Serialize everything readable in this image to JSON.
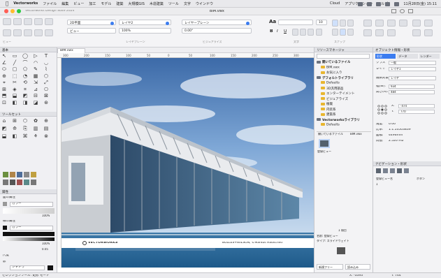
{
  "menubar": {
    "app": "Vectorworks",
    "items": [
      "ファイル",
      "編集",
      "ビュー",
      "加工",
      "モデル",
      "建築",
      "大規模GIS",
      "木造建築",
      "ツール",
      "文字",
      "ウインドウ"
    ],
    "right_items": [
      "Cloud",
      "アプリケーション",
      "ヘルプ"
    ],
    "datetime": "11月28日(金) 15:11"
  },
  "window": {
    "title": "Vectorworks Design Suite 2024",
    "document": "BIM.vwx"
  },
  "toolbar": {
    "layer_value": "2D平面",
    "class_value": "レイヤ2",
    "view_label": "ビュー",
    "plane_value": "レイヤープレーン",
    "group_labels": [
      "ビュー",
      "レイヤプレーン",
      "ビジュアライズ",
      "文字",
      "スナップ"
    ],
    "font_label": "Aa",
    "zoom_value": "100%",
    "angle_value": "0.00°",
    "text_size": "10",
    "buttons": [
      "B",
      "I",
      "U"
    ]
  },
  "doc_tab": "BIM.vwx",
  "ruler": {
    "h_ticks": [
      "300",
      "200",
      "150",
      "100",
      "50",
      "0",
      "50",
      "100",
      "150",
      "200",
      "250",
      "300"
    ]
  },
  "left_palettes": {
    "basic_title": "基本",
    "tool_title": "ツールセット",
    "attr_title": "属性",
    "fill_label": "面の属性",
    "fill_value": "カラー",
    "line_label": "線の属性",
    "line_value": "カラー",
    "opacity_value": "100%",
    "thickness_value": "0.05",
    "shadow_label": "影",
    "shadow_value": "シャドウ",
    "scale_label": "尺度"
  },
  "photo_credit": {
    "brand": "VECTORWORKS",
    "credit": "BOLLES+WILSON, ©Markus Hauschild"
  },
  "resource_browser": {
    "title": "リソースマネージャ",
    "sections": [
      {
        "label": "開いているファイル",
        "indent": 0
      },
      {
        "label": "BIM.vwx",
        "indent": 1
      },
      {
        "label": "お気に入り",
        "indent": 1
      },
      {
        "label": "デフォルトライブラリ",
        "indent": 0
      },
      {
        "label": "Defaults",
        "indent": 1
      },
      {
        "label": "3D汎用部品",
        "indent": 1
      },
      {
        "label": "エンターテイメント",
        "indent": 1
      },
      {
        "label": "ビジュアライズ",
        "indent": 1
      },
      {
        "label": "植栽",
        "indent": 1
      },
      {
        "label": "内装系",
        "indent": 1
      },
      {
        "label": "建築系",
        "indent": 1
      },
      {
        "label": "Vectorworksライブラリ",
        "indent": 0
      },
      {
        "label": "Defaults",
        "indent": 1
      }
    ],
    "tabs": [
      "開いているファイル",
      "BIM.vwx"
    ],
    "item_label": "登録ビュー",
    "count": "1 項目",
    "info_line1": "名前: 登録ビュー",
    "info_line2": "タイプ: スライドウェイト",
    "footer_new": "新規フリー",
    "footer_import": "読み込み"
  },
  "object_info": {
    "title": "オブジェクト情報・形状",
    "tabs": [
      "形状",
      "データ",
      "レンダー"
    ],
    "class_label": "クラス",
    "class_value": "一般",
    "layer_label": "レイヤ",
    "layer_value": "レイヤ1",
    "type_label": "選択対象",
    "type_value": "レイヤ",
    "fields": [
      {
        "label": "幅(W):",
        "value": "934"
      },
      {
        "label": "高さ(H):",
        "value": "484"
      },
      {
        "label": "X:",
        "value": "-474"
      },
      {
        "label": "Y:",
        "value": "770"
      }
    ],
    "extra": [
      {
        "label": "角度:",
        "value": "0.00°"
      },
      {
        "label": "比率:",
        "value": "1:1.53503839"
      },
      {
        "label": "面積:",
        "value": "4496mm"
      },
      {
        "label": "周長:",
        "value": "2.520 m2"
      }
    ],
    "section2_title": "ナビゲーション・形状",
    "section2_col1": "登録ビュー名",
    "section2_col2": "ボタン",
    "section2_row": "1"
  },
  "statusbar": {
    "left": "セレクションツール: 矩形 モード",
    "coord_x": "X: -3393",
    "coord_y": "Y: 744"
  }
}
